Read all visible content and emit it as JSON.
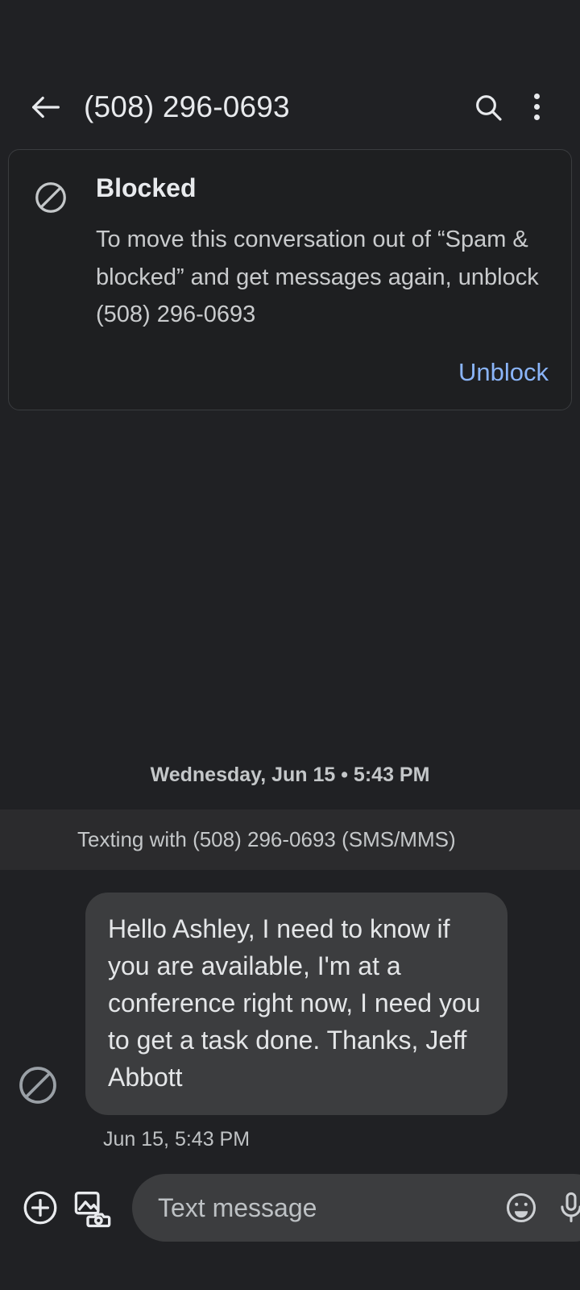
{
  "appbar": {
    "back_icon": "arrow-left-icon",
    "title": "(508) 296-0693",
    "search_icon": "search-icon",
    "overflow_icon": "more-vert-icon"
  },
  "blocked_card": {
    "icon": "block-icon",
    "title": "Blocked",
    "body": "To move this conversation out of “Spam & blocked” and get messages again, unblock (508) 296-0693",
    "action_label": "Unblock",
    "action_color": "#8ab4f8"
  },
  "conversation": {
    "date_divider": "Wednesday, Jun 15 • 5:43 PM",
    "texting_with": "Texting with (508) 296-0693 (SMS/MMS)",
    "messages": [
      {
        "avatar_icon": "block-icon",
        "text": "Hello Ashley, I need to know if you are available, I'm at a conference right now, I need you to get a task done. Thanks, Jeff Abbott",
        "timestamp": "Jun 15, 5:43 PM",
        "bubble_color": "#3c3d3f"
      }
    ]
  },
  "compose": {
    "plus_icon": "plus-circle-icon",
    "gallery_icon": "gallery-camera-icon",
    "placeholder": "Text message",
    "value": "",
    "emoji_icon": "emoji-smiley-icon",
    "mic_icon": "microphone-icon"
  },
  "theme": {
    "background": "#202124",
    "band_background": "#2b2b2d",
    "card_background": "#1e1f21",
    "text_primary": "#e8eaed",
    "text_secondary": "#c4c7c9"
  }
}
